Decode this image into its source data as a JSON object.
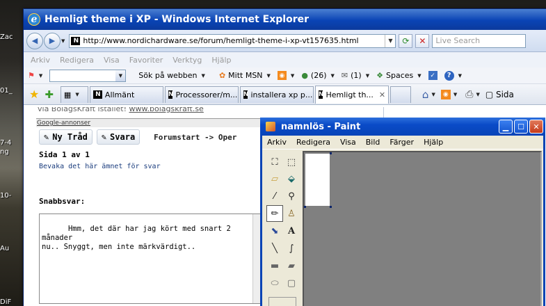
{
  "desktop": {
    "labels": [
      "Zac",
      "01_",
      "7-4",
      "ng",
      "10-",
      "Au",
      "DiF"
    ]
  },
  "ie": {
    "title": "Hemligt theme i XP - Windows Internet Explorer",
    "address": "http://www.nordichardware.se/forum/hemligt-theme-i-xp-vt157635.html",
    "search_placeholder": "Live Search",
    "menu": [
      "Arkiv",
      "Redigera",
      "Visa",
      "Favoriter",
      "Verktyg",
      "Hjälp"
    ],
    "links": {
      "search_web": "Sök på webben",
      "msn": "Mitt MSN",
      "count": "(26)",
      "mail": "(1)",
      "spaces": "Spaces"
    },
    "tabs": [
      "Allmänt",
      "Processorer/m...",
      "installera xp p...",
      "Hemligt th..."
    ],
    "tab_tools": {
      "page": "Sida"
    }
  },
  "page": {
    "top_text": "via BolagsKraft istället!",
    "top_link": "www.bolagskraft.se",
    "google_ads": "Google-annonser",
    "new_thread": "Ny Tråd",
    "reply": "Svara",
    "breadcrumb": "Forumstart -> Oper",
    "page_of": "Sida 1 av 1",
    "watch": "Bevaka det här ämnet för svar",
    "quick_reply": "Snabbsvar:",
    "reply_text": "Hmm, det där har jag kört med snart 2 månader\nnu.. Snyggt, men inte märkvärdigt.."
  },
  "paint": {
    "title": "namnlös - Paint",
    "menu": [
      "Arkiv",
      "Redigera",
      "Visa",
      "Bild",
      "Färger",
      "Hjälp"
    ]
  }
}
